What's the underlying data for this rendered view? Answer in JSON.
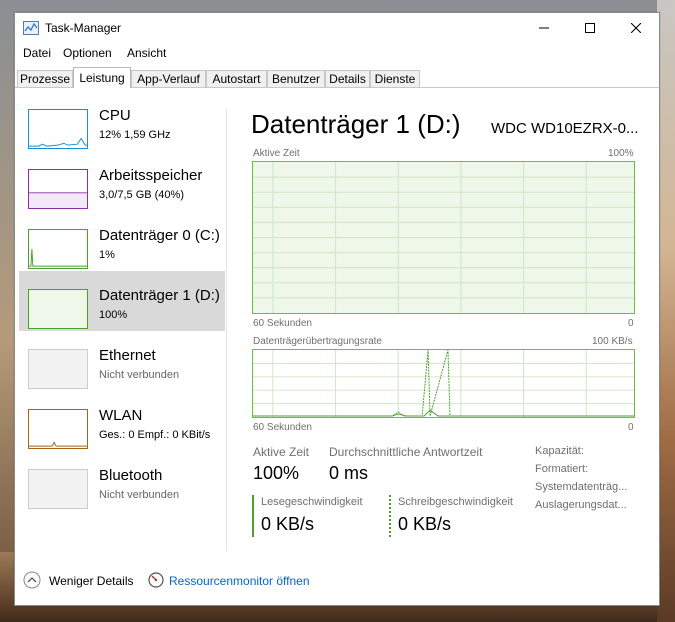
{
  "window": {
    "title": "Task-Manager"
  },
  "menu": [
    "Datei",
    "Optionen",
    "Ansicht"
  ],
  "tabs": [
    "Prozesse",
    "Leistung",
    "App-Verlauf",
    "Autostart",
    "Benutzer",
    "Details",
    "Dienste"
  ],
  "active_tab": "Leistung",
  "sidebar": {
    "items": [
      {
        "title": "CPU",
        "subtitle": "12%  1,59 GHz",
        "color": "#1a8fd6",
        "selected": false
      },
      {
        "title": "Arbeitsspeicher",
        "subtitle": "3,0/7,5 GB (40%)",
        "color": "#8b2fa6",
        "selected": false
      },
      {
        "title": "Datenträger 0 (C:)",
        "subtitle": "1%",
        "color": "#4ca02c",
        "selected": false
      },
      {
        "title": "Datenträger 1 (D:)",
        "subtitle": "100%",
        "color": "#4ca02c",
        "selected": true
      },
      {
        "title": "Ethernet",
        "subtitle": "Nicht verbunden",
        "color": "#cccccc",
        "selected": false
      },
      {
        "title": "WLAN",
        "subtitle": "Ges.: 0  Empf.: 0 KBit/s",
        "color": "#a7651b",
        "selected": false
      },
      {
        "title": "Bluetooth",
        "subtitle": "Nicht verbunden",
        "color": "#cccccc",
        "selected": false
      }
    ]
  },
  "main": {
    "title": "Datenträger 1 (D:)",
    "model": "WDC WD10EZRX-0...",
    "graph1": {
      "label": "Aktive Zeit",
      "max": "100%",
      "time": "60 Sekunden",
      "min": "0",
      "value_percent": 100
    },
    "graph2": {
      "label": "Datenträgerübertragungsrate",
      "max": "100 KB/s",
      "time": "60 Sekunden",
      "min": "0"
    },
    "stats": {
      "active_time_label": "Aktive Zeit",
      "active_time_value": "100%",
      "response_label": "Durchschnittliche Antwortzeit",
      "response_value": "0 ms",
      "read_label": "Lesegeschwindigkeit",
      "read_value": "0 KB/s",
      "write_label": "Schreibgeschwindigkeit",
      "write_value": "0 KB/s"
    },
    "props": [
      "Kapazität:",
      "Formatiert:",
      "Systemdatenträg...",
      "Auslagerungsdat..."
    ]
  },
  "footer": {
    "fewer_details": "Weniger Details",
    "resource_monitor": "Ressourcenmonitor öffnen"
  },
  "colors": {
    "disk_green": "#4ca02c",
    "disk_fill": "#eef7e9",
    "selected_bg": "#d9d9d9",
    "link_blue": "#0066cc"
  }
}
